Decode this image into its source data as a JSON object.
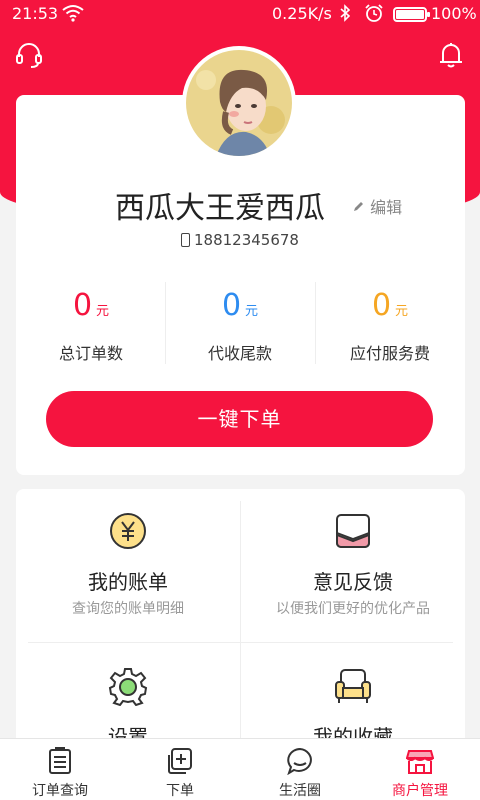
{
  "status_bar": {
    "time": "21:53",
    "speed": "0.25K/s",
    "battery": "100%"
  },
  "profile": {
    "username": "西瓜大王爱西瓜",
    "edit_label": "编辑",
    "phone": "18812345678"
  },
  "stats": [
    {
      "value": "0",
      "unit": "元",
      "label": "总订单数",
      "color": "#f5143f"
    },
    {
      "value": "0",
      "unit": "元",
      "label": "代收尾款",
      "color": "#2e8cf0"
    },
    {
      "value": "0",
      "unit": "元",
      "label": "应付服务费",
      "color": "#f5a623"
    }
  ],
  "order_button": "一键下单",
  "menu": [
    {
      "title": "我的账单",
      "subtitle": "查询您的账单明细",
      "icon": "yen-coin-icon"
    },
    {
      "title": "意见反馈",
      "subtitle": "以便我们更好的优化产品",
      "icon": "feedback-icon"
    },
    {
      "title": "设置",
      "subtitle": "",
      "icon": "gear-icon"
    },
    {
      "title": "我的收藏",
      "subtitle": "",
      "icon": "sofa-icon"
    }
  ],
  "tabs": [
    {
      "label": "订单查询",
      "icon": "clipboard-icon",
      "active": false
    },
    {
      "label": "下单",
      "icon": "add-order-icon",
      "active": false
    },
    {
      "label": "生活圈",
      "icon": "chat-bubble-icon",
      "active": false
    },
    {
      "label": "商户管理",
      "icon": "store-icon",
      "active": true
    }
  ],
  "colors": {
    "brand": "#f5143f",
    "background": "#f3f3f3"
  }
}
